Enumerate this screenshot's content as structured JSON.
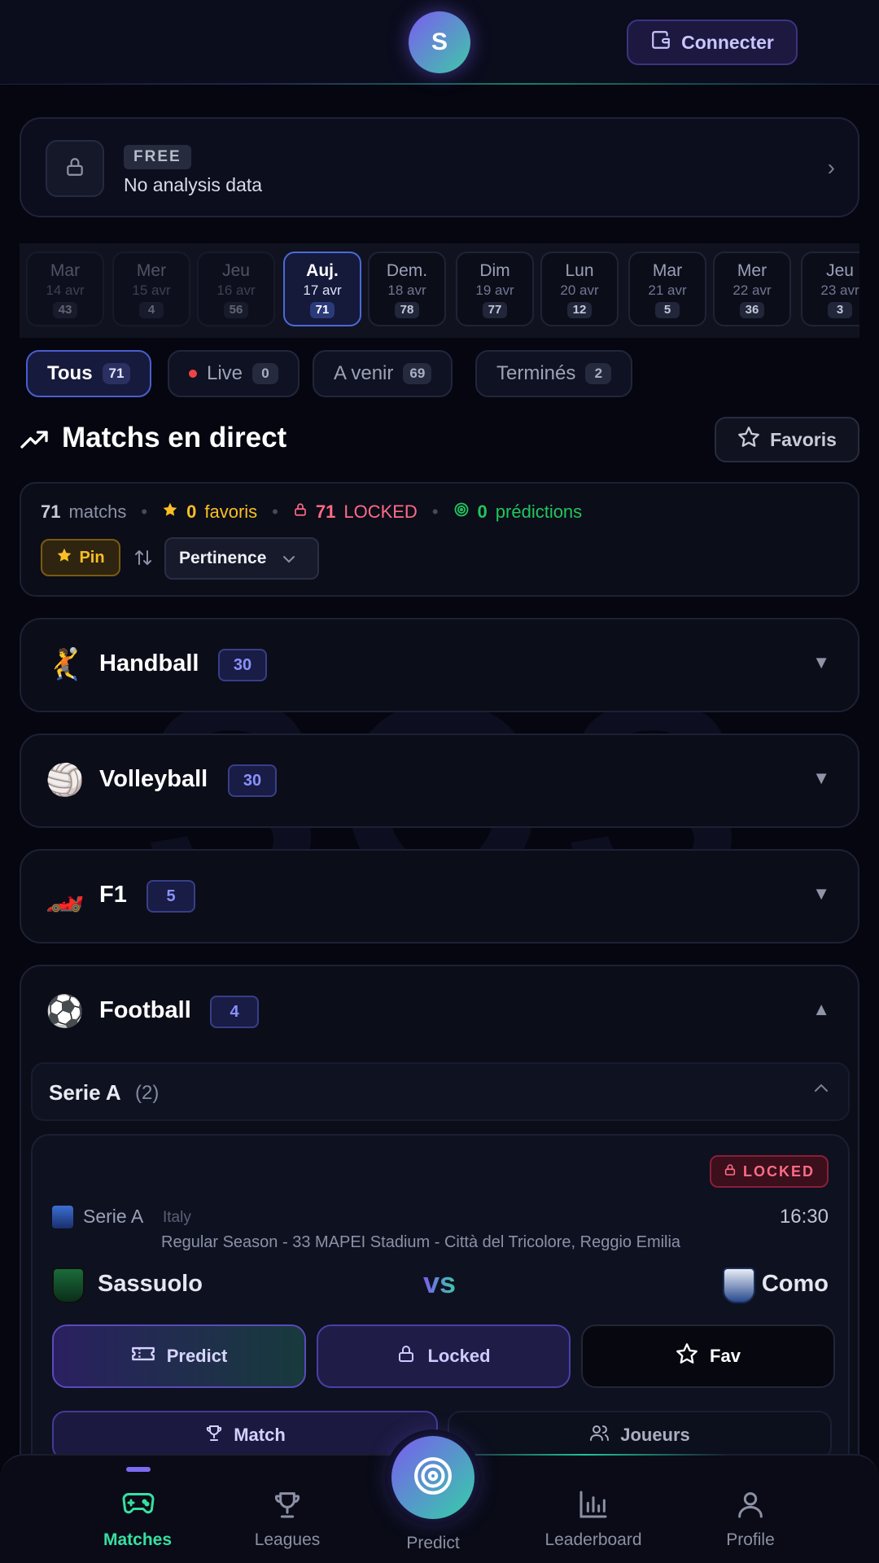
{
  "header": {
    "logo_letter": "S",
    "connect_label": "Connecter"
  },
  "plan": {
    "badge": "FREE",
    "text": "No analysis data"
  },
  "dates": [
    {
      "day": "Mar",
      "date": "14 avr",
      "count": "43",
      "state": "past"
    },
    {
      "day": "Mer",
      "date": "15 avr",
      "count": "4",
      "state": "past"
    },
    {
      "day": "Jeu",
      "date": "16 avr",
      "count": "56",
      "state": "past"
    },
    {
      "day": "Auj.",
      "date": "17 avr",
      "count": "71",
      "state": "active"
    },
    {
      "day": "Dem.",
      "date": "18 avr",
      "count": "78",
      "state": "future"
    },
    {
      "day": "Dim",
      "date": "19 avr",
      "count": "77",
      "state": "future"
    },
    {
      "day": "Lun",
      "date": "20 avr",
      "count": "12",
      "state": "future"
    },
    {
      "day": "Mar",
      "date": "21 avr",
      "count": "5",
      "state": "future"
    },
    {
      "day": "Mer",
      "date": "22 avr",
      "count": "36",
      "state": "future"
    },
    {
      "day": "Jeu",
      "date": "23 avr",
      "count": "3",
      "state": "future"
    }
  ],
  "tabs": [
    {
      "label": "Tous",
      "count": "71"
    },
    {
      "label": "Live",
      "count": "0"
    },
    {
      "label": "A venir",
      "count": "69"
    },
    {
      "label": "Terminés",
      "count": "2"
    }
  ],
  "section": {
    "title": "Matchs en direct",
    "favorites_label": "Favoris"
  },
  "stats": {
    "matches_count": "71",
    "matches_label": "matchs",
    "favorites_count": "0",
    "favorites_label": "favoris",
    "locked_count": "71",
    "locked_label": "LOCKED",
    "predictions_count": "0",
    "predictions_label": "prédictions",
    "pin_label": "Pin",
    "sort_label": "Pertinence"
  },
  "sports": [
    {
      "emoji": "🤾",
      "name": "Handball",
      "count": "30",
      "arrow": "▼"
    },
    {
      "emoji": "🏐",
      "name": "Volleyball",
      "count": "30",
      "arrow": "▼"
    },
    {
      "emoji": "🏎️",
      "name": "F1",
      "count": "5",
      "arrow": "▼"
    },
    {
      "emoji": "⚽",
      "name": "Football",
      "count": "4",
      "arrow": "▲"
    }
  ],
  "league": {
    "name": "Serie A",
    "count": "(2)"
  },
  "match": {
    "locked_label": "LOCKED",
    "competition": "Serie A",
    "country": "Italy",
    "time": "16:30",
    "round": "Regular Season - 33   MAPEI Stadium - Città del Tricolore, Reggio Emilia",
    "home": "Sassuolo",
    "away": "Como",
    "vs": "vs",
    "predict_label": "Predict",
    "locked_btn_label": "Locked",
    "fav_label": "Fav",
    "tab_match": "Match",
    "tab_players": "Joueurs"
  },
  "watermark": "SOS",
  "nav": {
    "matches": "Matches",
    "leagues": "Leagues",
    "predict": "Predict",
    "leaderboard": "Leaderboard",
    "profile": "Profile"
  },
  "colors": {
    "accent_green": "#37e0a0",
    "accent_purple": "#7b5cf0",
    "locked_red": "#ff6b86",
    "favorite_yellow": "#fbbf24",
    "predictions_green": "#22c55e"
  }
}
